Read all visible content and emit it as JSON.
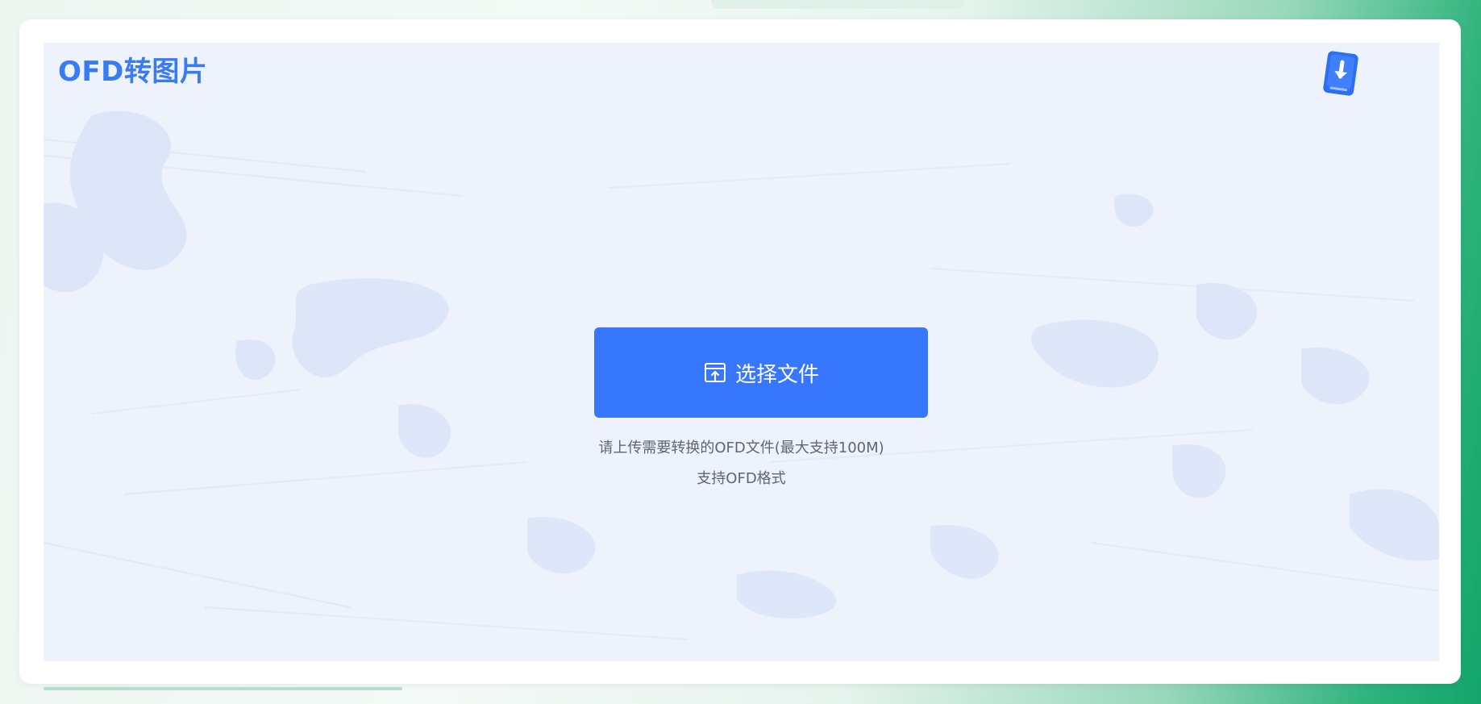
{
  "app": {
    "title": "OFD转图片"
  },
  "upload": {
    "button_label": "选择文件",
    "hint_line1": "请上传需要转换的OFD文件(最大支持100M)",
    "hint_line2": "支持OFD格式"
  },
  "icons": {
    "download": "download-icon",
    "folder": "folder-upload-icon"
  },
  "colors": {
    "accent": "#3677fd",
    "title": "#3a7af2",
    "panel_bg": "#edf2fb",
    "hint_text": "#5e6673"
  }
}
